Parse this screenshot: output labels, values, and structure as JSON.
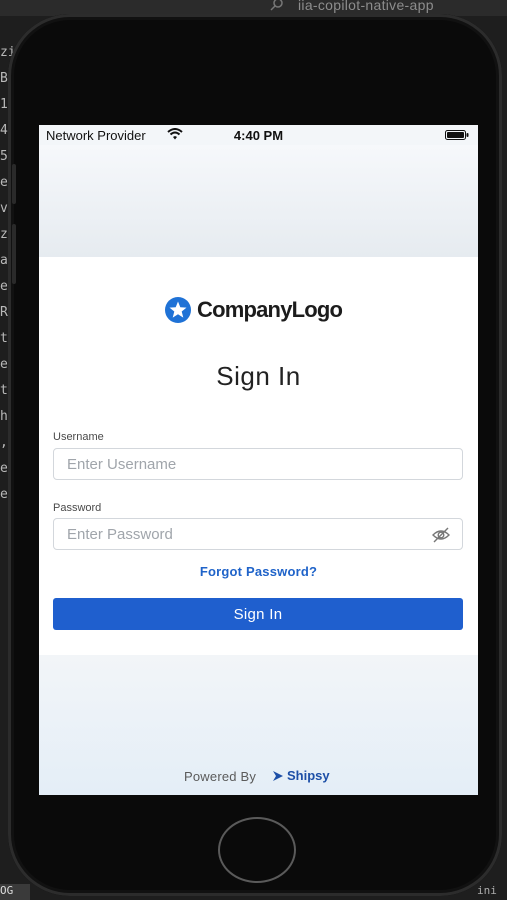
{
  "background_editor": {
    "title": "iia-copilot-native-app",
    "gutter_letters": [
      "zi",
      "B",
      "1",
      "4",
      "5",
      "e",
      "v",
      "z",
      "a",
      "e",
      "R",
      "t",
      "e",
      "t",
      "h",
      ",",
      "e",
      "e"
    ],
    "badge_left": "OG",
    "badge_right": "ini"
  },
  "status_bar": {
    "carrier": "Network Provider",
    "time": "4:40 PM"
  },
  "login": {
    "logo_text": "CompanyLogo",
    "title": "Sign In",
    "username_label": "Username",
    "username_placeholder": "Enter Username",
    "username_value": "",
    "password_label": "Password",
    "password_placeholder": "Enter Password",
    "password_value": "",
    "forgot_label": "Forgot Password?",
    "signin_label": "Sign In"
  },
  "footer": {
    "powered_by": "Powered By",
    "brand": "Shipsy"
  },
  "colors": {
    "primary": "#1f5fce",
    "link": "#1f63c9",
    "logo_badge": "#1f72d6"
  },
  "icons": [
    "search-icon",
    "wifi-icon",
    "battery-icon",
    "logo-star-icon",
    "eye-off-icon",
    "shipsy-logo-icon"
  ]
}
